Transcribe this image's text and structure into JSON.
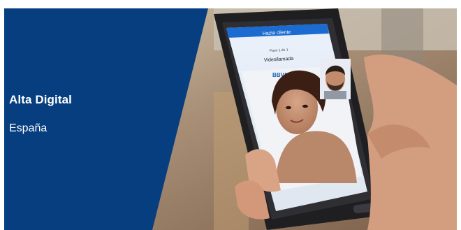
{
  "banner": {
    "title": "Alta Digital",
    "subtitle": "España",
    "panel_color": "#073e80"
  },
  "phone": {
    "header_title": "Hazte cliente",
    "step_text": "Paso 1 de 1",
    "screen_title": "Videollamada",
    "brand_text": "BBVA"
  }
}
